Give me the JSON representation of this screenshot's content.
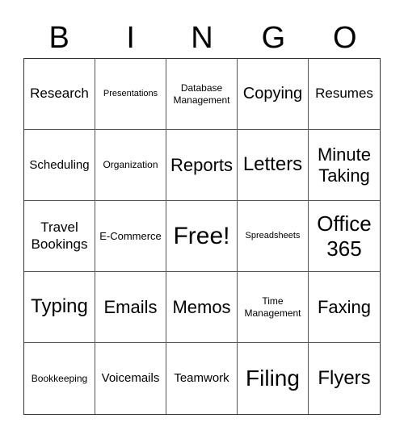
{
  "header": [
    "B",
    "I",
    "N",
    "G",
    "O"
  ],
  "cells": [
    {
      "text": "Research",
      "size": "s17"
    },
    {
      "text": "Presentations",
      "size": "s11"
    },
    {
      "text": "Database Management",
      "size": "s12"
    },
    {
      "text": "Copying",
      "size": "s20"
    },
    {
      "text": "Resumes",
      "size": "s17"
    },
    {
      "text": "Scheduling",
      "size": "s15"
    },
    {
      "text": "Organization",
      "size": "s12"
    },
    {
      "text": "Reports",
      "size": "s22"
    },
    {
      "text": "Letters",
      "size": "s24"
    },
    {
      "text": "Minute Taking",
      "size": "s22"
    },
    {
      "text": "Travel Bookings",
      "size": "s17"
    },
    {
      "text": "E-Commerce",
      "size": "s13"
    },
    {
      "text": "Free!",
      "size": "s30"
    },
    {
      "text": "Spreadsheets",
      "size": "s11"
    },
    {
      "text": "Office 365",
      "size": "s26"
    },
    {
      "text": "Typing",
      "size": "s24"
    },
    {
      "text": "Emails",
      "size": "s22"
    },
    {
      "text": "Memos",
      "size": "s22"
    },
    {
      "text": "Time Management",
      "size": "s12"
    },
    {
      "text": "Faxing",
      "size": "s22"
    },
    {
      "text": "Bookkeeping",
      "size": "s12"
    },
    {
      "text": "Voicemails",
      "size": "s15"
    },
    {
      "text": "Teamwork",
      "size": "s15"
    },
    {
      "text": "Filing",
      "size": "s28"
    },
    {
      "text": "Flyers",
      "size": "s24"
    }
  ]
}
